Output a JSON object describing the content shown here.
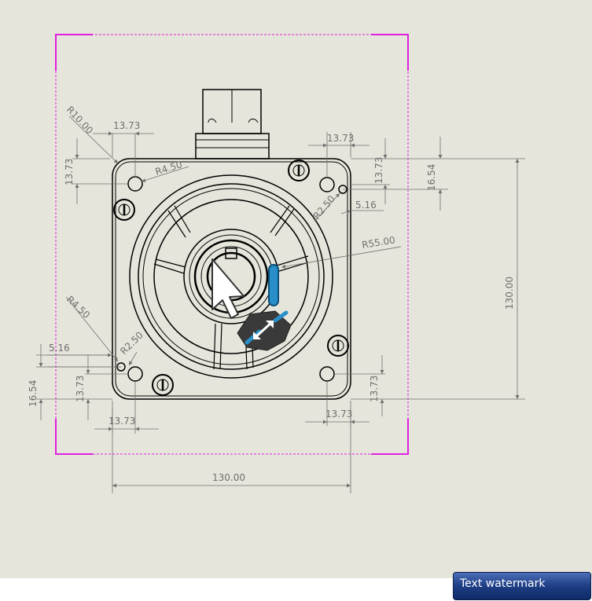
{
  "drawing": {
    "dims": {
      "r_top_left": "R10.00",
      "w_top_left": "13.73",
      "h_top_left": "13.73",
      "r_hole": "R4.50",
      "w_top_right": "13.73",
      "h_top_right": "13.73",
      "h_tab_right": "16.54",
      "r_tab": "R2.50",
      "w_tab": "5.16",
      "r_body": "R55.00",
      "h_overall": "130.00",
      "r_hole_bl": "R4.50",
      "r_tab_bl": "R2.50",
      "w_tab_bl": "5.16",
      "h_tab_bl": "16.54",
      "h_bottom_left": "13.73",
      "w_bottom_left": "13.73",
      "h_bottom_right": "13.73",
      "w_bottom_right": "13.73",
      "w_overall": "130.00"
    }
  },
  "watermark": {
    "label": "Text watermark"
  },
  "colors": {
    "background": "#e6e5db",
    "sheet_border": "#e020e0",
    "line": "#000000",
    "dimension": "#707070",
    "accent": "#2a8fc8"
  },
  "icons": {
    "cursor": "arrow-pointer-icon",
    "move": "move-dimension-icon"
  }
}
